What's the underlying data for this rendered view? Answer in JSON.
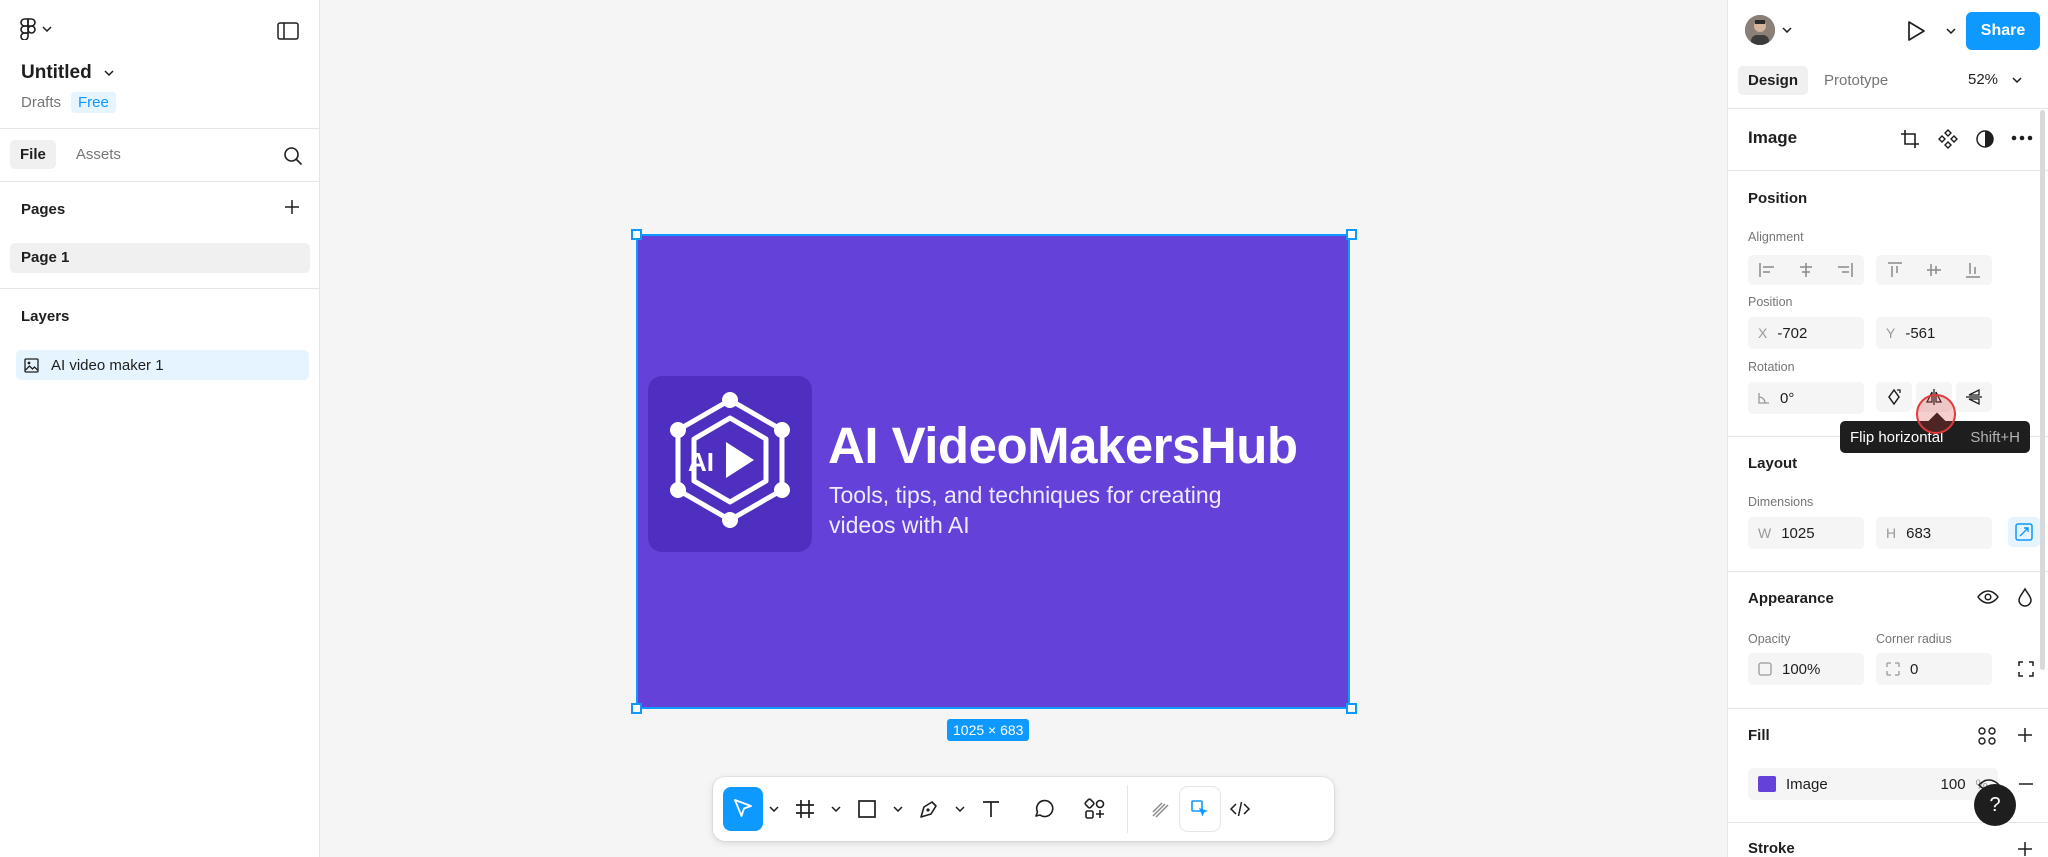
{
  "file": {
    "title": "Untitled",
    "location": "Drafts",
    "plan": "Free"
  },
  "left_panel": {
    "tabs": [
      "File",
      "Assets"
    ],
    "pages_heading": "Pages",
    "pages": [
      "Page 1"
    ],
    "layers_heading": "Layers",
    "layers": [
      "AI video maker 1"
    ]
  },
  "canvas": {
    "image_title": "AI VideoMakersHub",
    "image_subtitle": "Tools, tips, and techniques for creating videos with AI",
    "logo_text": "AI",
    "dimensions_badge": "1025 × 683"
  },
  "toolbar": {
    "tools": [
      "move-tool",
      "frame-tool",
      "shape-tool",
      "pen-tool",
      "text-tool",
      "comment-tool",
      "actions-tool",
      "draw-mode",
      "design-mode",
      "dev-mode"
    ]
  },
  "right_panel": {
    "share_label": "Share",
    "tabs": [
      "Design",
      "Prototype"
    ],
    "zoom": "52%",
    "selection_title": "Image",
    "position_heading": "Position",
    "alignment_label": "Alignment",
    "position_label": "Position",
    "x_prefix": "X",
    "x_value": "-702",
    "y_prefix": "Y",
    "y_value": "-561",
    "rotation_label": "Rotation",
    "rotation_value": "0°",
    "layout_heading": "Layout",
    "dimensions_label": "Dimensions",
    "w_prefix": "W",
    "w_value": "1025",
    "h_prefix": "H",
    "h_value": "683",
    "appearance_heading": "Appearance",
    "opacity_label": "Opacity",
    "opacity_value": "100%",
    "corner_radius_label": "Corner radius",
    "corner_radius_value": "0",
    "fill_heading": "Fill",
    "fill_type": "Image",
    "fill_opacity": "100",
    "fill_unit": "%",
    "stroke_heading": "Stroke"
  },
  "tooltip": {
    "label": "Flip horizontal",
    "shortcut": "Shift+H"
  },
  "help_label": "?",
  "colors": {
    "accent": "#0d99ff",
    "image_bg": "#6441d8",
    "logo_bg": "#4e2fc0"
  }
}
